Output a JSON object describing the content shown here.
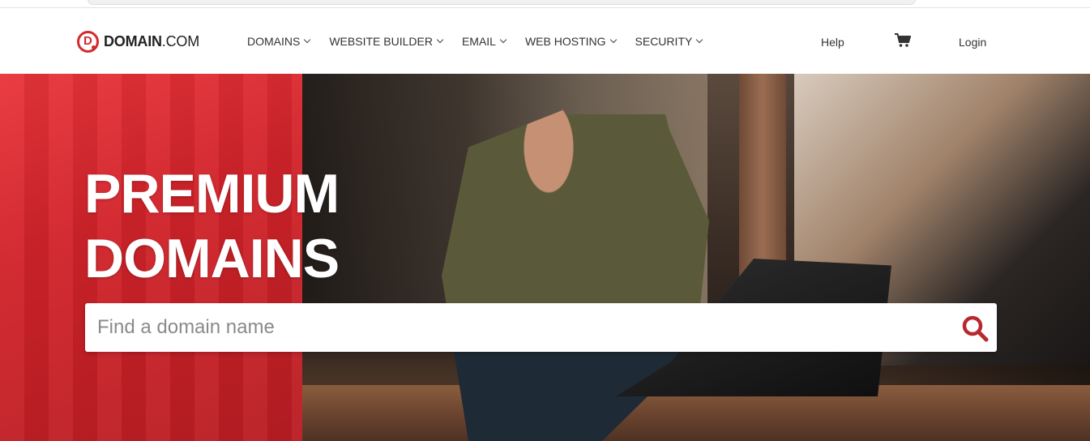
{
  "brand": {
    "name_bold": "DOMAIN",
    "name_rest": ".COM",
    "logo_letter": "D",
    "accent": "#d42a2f"
  },
  "nav": {
    "items": [
      {
        "label": "DOMAINS"
      },
      {
        "label": "WEBSITE BUILDER"
      },
      {
        "label": "EMAIL"
      },
      {
        "label": "WEB HOSTING"
      },
      {
        "label": "SECURITY"
      }
    ],
    "help": "Help",
    "cart_icon": "cart-icon",
    "login": "Login"
  },
  "hero": {
    "title_line1": "PREMIUM",
    "title_line2": "DOMAINS"
  },
  "search": {
    "placeholder": "Find a domain name",
    "value": "",
    "icon": "search-icon"
  }
}
